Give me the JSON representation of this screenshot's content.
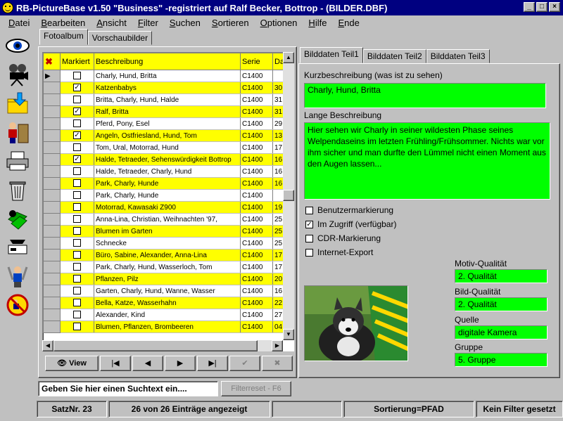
{
  "title": "RB-PictureBase v1.50 \"Business\"  -registriert auf Ralf Becker, Bottrop - (BILDER.DBF)",
  "menu": [
    "Datei",
    "Bearbeiten",
    "Ansicht",
    "Filter",
    "Suchen",
    "Sortieren",
    "Optionen",
    "Hilfe",
    "Ende"
  ],
  "left_tabs": [
    "Fotoalbum",
    "Vorschaubilder"
  ],
  "grid": {
    "headers": {
      "markiert": "Markiert",
      "beschreibung": "Beschreibung",
      "serie": "Serie",
      "da": "Da"
    },
    "rows": [
      {
        "m": false,
        "desc": "Charly, Hund, Britta",
        "serie": "C1400",
        "d": "",
        "yellow": false,
        "cur": true
      },
      {
        "m": true,
        "desc": "Katzenbabys",
        "serie": "C1400",
        "d": "30",
        "yellow": true
      },
      {
        "m": false,
        "desc": "Britta, Charly, Hund, Halde",
        "serie": "C1400",
        "d": "31",
        "yellow": false
      },
      {
        "m": true,
        "desc": "Ralf, Britta",
        "serie": "C1400",
        "d": "31",
        "yellow": true
      },
      {
        "m": false,
        "desc": "Pferd, Pony, Esel",
        "serie": "C1400",
        "d": "29",
        "yellow": false
      },
      {
        "m": true,
        "desc": "Angeln, Ostfriesland, Hund, Tom",
        "serie": "C1400",
        "d": "13",
        "yellow": true
      },
      {
        "m": false,
        "desc": "Tom, Ural, Motorrad, Hund",
        "serie": "C1400",
        "d": "17",
        "yellow": false
      },
      {
        "m": true,
        "desc": "Halde, Tetraeder, Sehenswürdigkeit Bottrop",
        "serie": "C1400",
        "d": "16",
        "yellow": true
      },
      {
        "m": false,
        "desc": "Halde, Tetraeder, Charly, Hund",
        "serie": "C1400",
        "d": "16",
        "yellow": false
      },
      {
        "m": false,
        "desc": "Park, Charly, Hunde",
        "serie": "C1400",
        "d": "16",
        "yellow": true
      },
      {
        "m": false,
        "desc": "Park, Charly, Hunde",
        "serie": "C1400",
        "d": "",
        "yellow": false
      },
      {
        "m": false,
        "desc": "Motorrad, Kawasaki Z900",
        "serie": "C1400",
        "d": "19",
        "yellow": true
      },
      {
        "m": false,
        "desc": "Anna-Lina, Christian,  Weihnachten '97,",
        "serie": "C1400",
        "d": "25",
        "yellow": false
      },
      {
        "m": false,
        "desc": "Blumen im Garten",
        "serie": "C1400",
        "d": "25",
        "yellow": true
      },
      {
        "m": false,
        "desc": "Schnecke",
        "serie": "C1400",
        "d": "25",
        "yellow": false
      },
      {
        "m": false,
        "desc": "Büro, Sabine, Alexander, Anna-Lina",
        "serie": "C1400",
        "d": "17",
        "yellow": true
      },
      {
        "m": false,
        "desc": "Park, Charly, Hund, Wasserloch, Tom",
        "serie": "C1400",
        "d": "17",
        "yellow": false
      },
      {
        "m": false,
        "desc": "Pflanzen, Pilz",
        "serie": "C1400",
        "d": "20",
        "yellow": true
      },
      {
        "m": false,
        "desc": "Garten, Charly, Hund, Wanne, Wasser",
        "serie": "C1400",
        "d": "16",
        "yellow": false
      },
      {
        "m": false,
        "desc": "Bella, Katze, Wasserhahn",
        "serie": "C1400",
        "d": "22",
        "yellow": true
      },
      {
        "m": false,
        "desc": "Alexander, Kind",
        "serie": "C1400",
        "d": "27",
        "yellow": false
      },
      {
        "m": false,
        "desc": "Blumen, Pflanzen, Brombeeren",
        "serie": "C1400",
        "d": "04",
        "yellow": true
      }
    ]
  },
  "nav": {
    "view": "View"
  },
  "right_tabs": [
    "Bilddaten Teil1",
    "Bilddaten Teil2",
    "Bilddaten Teil3"
  ],
  "kurz": {
    "label": "Kurzbeschreibung (was ist zu sehen)",
    "value": "Charly, Hund, Britta"
  },
  "lang": {
    "label": "Lange Beschreibung",
    "value": "Hier sehen wir Charly in seiner wildesten Phase seines Welpendaseins im letzten Frühling/Frühsommer. Nichts war vor ihm sicher und man durfte den Lümmel nicht einen Moment aus den Augen lassen..."
  },
  "checks": [
    {
      "label": "Benutzermarkierung",
      "checked": false
    },
    {
      "label": "Im Zugriff  (verfügbar)",
      "checked": true
    },
    {
      "label": "CDR-Markierung",
      "checked": false
    },
    {
      "label": "Internet-Export",
      "checked": false
    }
  ],
  "quality": {
    "motiv_label": "Motiv-Qualität",
    "motiv_value": "2. Qualität",
    "bild_label": "Bild-Qualität",
    "bild_value": "2. Qualität",
    "quelle_label": "Quelle",
    "quelle_value": "digitale Kamera",
    "gruppe_label": "Gruppe",
    "gruppe_value": "5. Gruppe"
  },
  "search": {
    "placeholder": "Geben Sie hier einen Suchtext ein....",
    "filterreset": "Filterreset - F6"
  },
  "status": {
    "satz": "SatzNr. 23",
    "count": "26 von 26 Einträge angezeigt",
    "sort": "Sortierung=PFAD",
    "filter": "Kein Filter gesetzt"
  },
  "icons": [
    "eye-icon",
    "movie-camera-icon",
    "folder-import-icon",
    "person-archive-icon",
    "printer-icon",
    "trash-icon",
    "recycle-disk-icon",
    "scanner-icon",
    "tools-person-icon",
    "no-smoking-exit-icon"
  ]
}
